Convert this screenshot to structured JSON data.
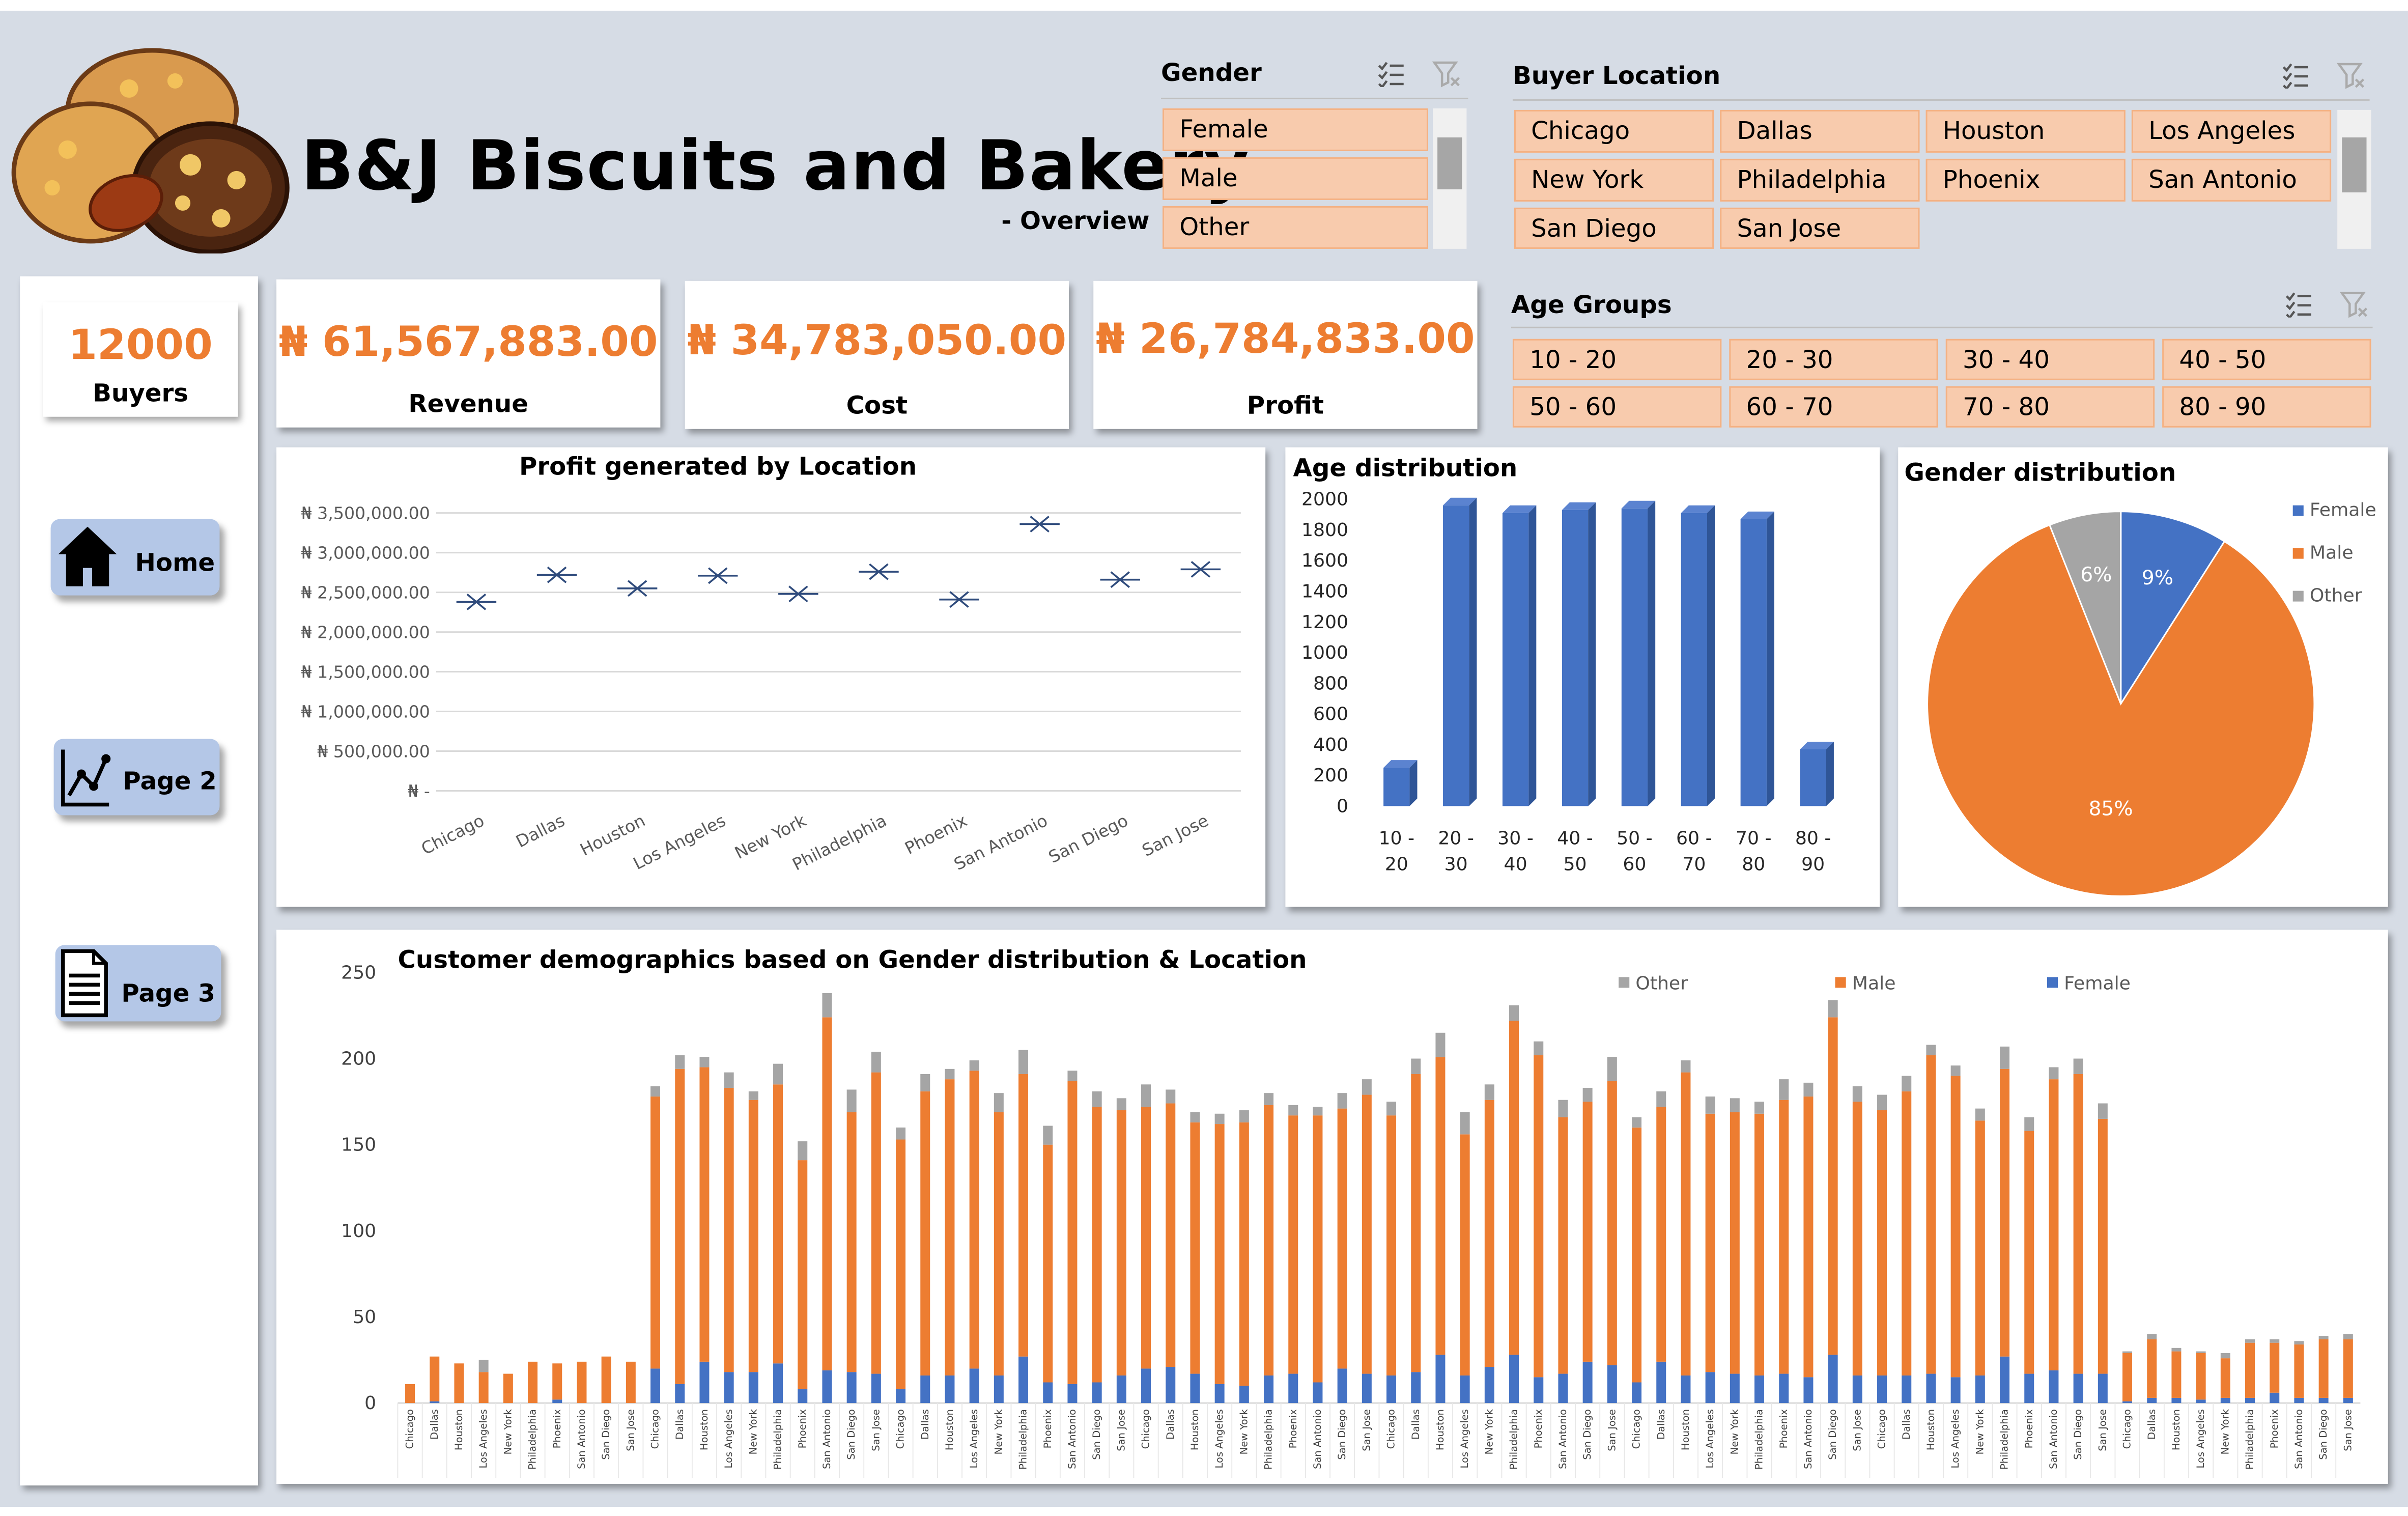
{
  "header": {
    "title": "B&J Biscuits and Bakery",
    "subtitle": "- Overview"
  },
  "gender_slicer": {
    "label": "Gender",
    "items": [
      "Female",
      "Male",
      "Other"
    ]
  },
  "location_slicer": {
    "label": "Buyer Location",
    "items": [
      "Chicago",
      "Dallas",
      "Houston",
      "Los Angeles",
      "New York",
      "Philadelphia",
      "Phoenix",
      "San Antonio",
      "San Diego",
      "San Jose"
    ]
  },
  "age_slicer": {
    "label": "Age Groups",
    "items": [
      "10 - 20",
      "20 - 30",
      "30 - 40",
      "40 - 50",
      "50 - 60",
      "60 - 70",
      "70 - 80",
      "80 - 90"
    ]
  },
  "kpis": {
    "buyers": {
      "value": "12000",
      "label": "Buyers"
    },
    "revenue": {
      "value": "₦ 61,567,883.00",
      "label": "Revenue"
    },
    "cost": {
      "value": "₦ 34,783,050.00",
      "label": "Cost"
    },
    "profit": {
      "value": "₦ 26,784,833.00",
      "label": "Profit"
    }
  },
  "nav": {
    "home": "Home",
    "page2": "Page 2",
    "page3": "Page 3"
  },
  "colors": {
    "female": "#4472c4",
    "male": "#ed7d31",
    "other": "#a5a5a5",
    "chip": "#f8cbad",
    "background": "#d6dce5"
  },
  "chart_data": [
    {
      "type": "scatter",
      "title": "Profit generated by Location",
      "categories": [
        "Chicago",
        "Dallas",
        "Houston",
        "Los Angeles",
        "New York",
        "Philadelphia",
        "Phoenix",
        "San Antonio",
        "San Diego",
        "San Jose"
      ],
      "values": [
        2380000,
        2720000,
        2550000,
        2710000,
        2480000,
        2760000,
        2410000,
        3360000,
        2660000,
        2790000
      ],
      "ylim": [
        0,
        3500000
      ],
      "yticks": [
        "₦ -",
        "₦ 500,000.00",
        "₦ 1,000,000.00",
        "₦ 1,500,000.00",
        "₦ 2,000,000.00",
        "₦ 2,500,000.00",
        "₦ 3,000,000.00",
        "₦ 3,500,000.00"
      ],
      "marker": "x",
      "grid": true
    },
    {
      "type": "bar",
      "title": "Age distribution",
      "categories": [
        [
          "10 -",
          "20"
        ],
        [
          "20 -",
          "30"
        ],
        [
          "30 -",
          "40"
        ],
        [
          "40 -",
          "50"
        ],
        [
          "50 -",
          "60"
        ],
        [
          "60 -",
          "70"
        ],
        [
          "70 -",
          "80"
        ],
        [
          "80 -",
          "90"
        ]
      ],
      "values": [
        250,
        1960,
        1910,
        1930,
        1940,
        1910,
        1870,
        370
      ],
      "ylim": [
        0,
        2000
      ],
      "yticks": [
        "0",
        "200",
        "400",
        "600",
        "800",
        "1000",
        "1200",
        "1400",
        "1600",
        "1800",
        "2000"
      ]
    },
    {
      "type": "pie",
      "title": "Gender distribution",
      "series": [
        {
          "name": "Female",
          "value": 9,
          "label": "9%"
        },
        {
          "name": "Male",
          "value": 85,
          "label": "85%"
        },
        {
          "name": "Other",
          "value": 6,
          "label": "6%"
        }
      ],
      "legend": "right"
    },
    {
      "type": "bar",
      "stacked": true,
      "title": "Customer demographics based on Gender distribution & Location",
      "location_cycle": [
        "Chicago",
        "Dallas",
        "Houston",
        "Los Angeles",
        "New York",
        "Philadelphia",
        "Phoenix",
        "San Antonio",
        "San Diego",
        "San Jose"
      ],
      "ylim": [
        0,
        250
      ],
      "yticks": [
        "0",
        "50",
        "100",
        "150",
        "200",
        "250"
      ],
      "legend_order": [
        "Other",
        "Male",
        "Female"
      ],
      "legend": "top",
      "series": [
        {
          "name": "Female",
          "values": [
            0,
            1,
            0,
            0,
            0,
            0,
            2,
            0,
            0,
            0,
            20,
            11,
            24,
            18,
            18,
            23,
            8,
            19,
            18,
            17,
            8,
            16,
            16,
            20,
            16,
            27,
            12,
            11,
            12,
            16,
            20,
            21,
            17,
            11,
            10,
            16,
            17,
            12,
            20,
            17,
            16,
            18,
            28,
            16,
            21,
            28,
            15,
            17,
            24,
            22,
            12,
            24,
            16,
            18,
            17,
            16,
            17,
            15,
            28,
            16,
            16,
            16,
            17,
            15,
            16,
            27,
            17,
            19,
            17,
            17,
            1,
            3,
            3,
            2,
            3,
            3,
            6,
            3,
            3,
            3
          ]
        },
        {
          "name": "Male",
          "values": [
            11,
            26,
            23,
            18,
            17,
            24,
            21,
            24,
            27,
            24,
            158,
            183,
            171,
            165,
            158,
            162,
            133,
            205,
            151,
            175,
            145,
            165,
            172,
            173,
            153,
            164,
            138,
            176,
            160,
            154,
            152,
            153,
            146,
            151,
            153,
            157,
            150,
            155,
            151,
            162,
            151,
            173,
            173,
            140,
            155,
            194,
            187,
            149,
            151,
            165,
            148,
            148,
            176,
            150,
            152,
            152,
            159,
            163,
            196,
            159,
            154,
            165,
            185,
            175,
            148,
            167,
            141,
            169,
            174,
            148,
            28,
            34,
            27,
            27,
            23,
            32,
            29,
            31,
            34,
            34
          ]
        },
        {
          "name": "Other",
          "values": [
            0,
            0,
            0,
            7,
            0,
            0,
            0,
            0,
            0,
            0,
            6,
            8,
            6,
            9,
            5,
            12,
            11,
            14,
            13,
            12,
            7,
            10,
            6,
            6,
            11,
            14,
            11,
            6,
            9,
            7,
            13,
            8,
            6,
            6,
            7,
            7,
            6,
            5,
            9,
            9,
            8,
            9,
            14,
            13,
            9,
            9,
            8,
            10,
            8,
            14,
            6,
            9,
            7,
            10,
            8,
            7,
            12,
            8,
            10,
            9,
            9,
            9,
            6,
            6,
            7,
            13,
            8,
            7,
            9,
            9,
            1,
            3,
            2,
            1,
            3,
            2,
            2,
            2,
            2,
            3
          ]
        }
      ]
    }
  ]
}
